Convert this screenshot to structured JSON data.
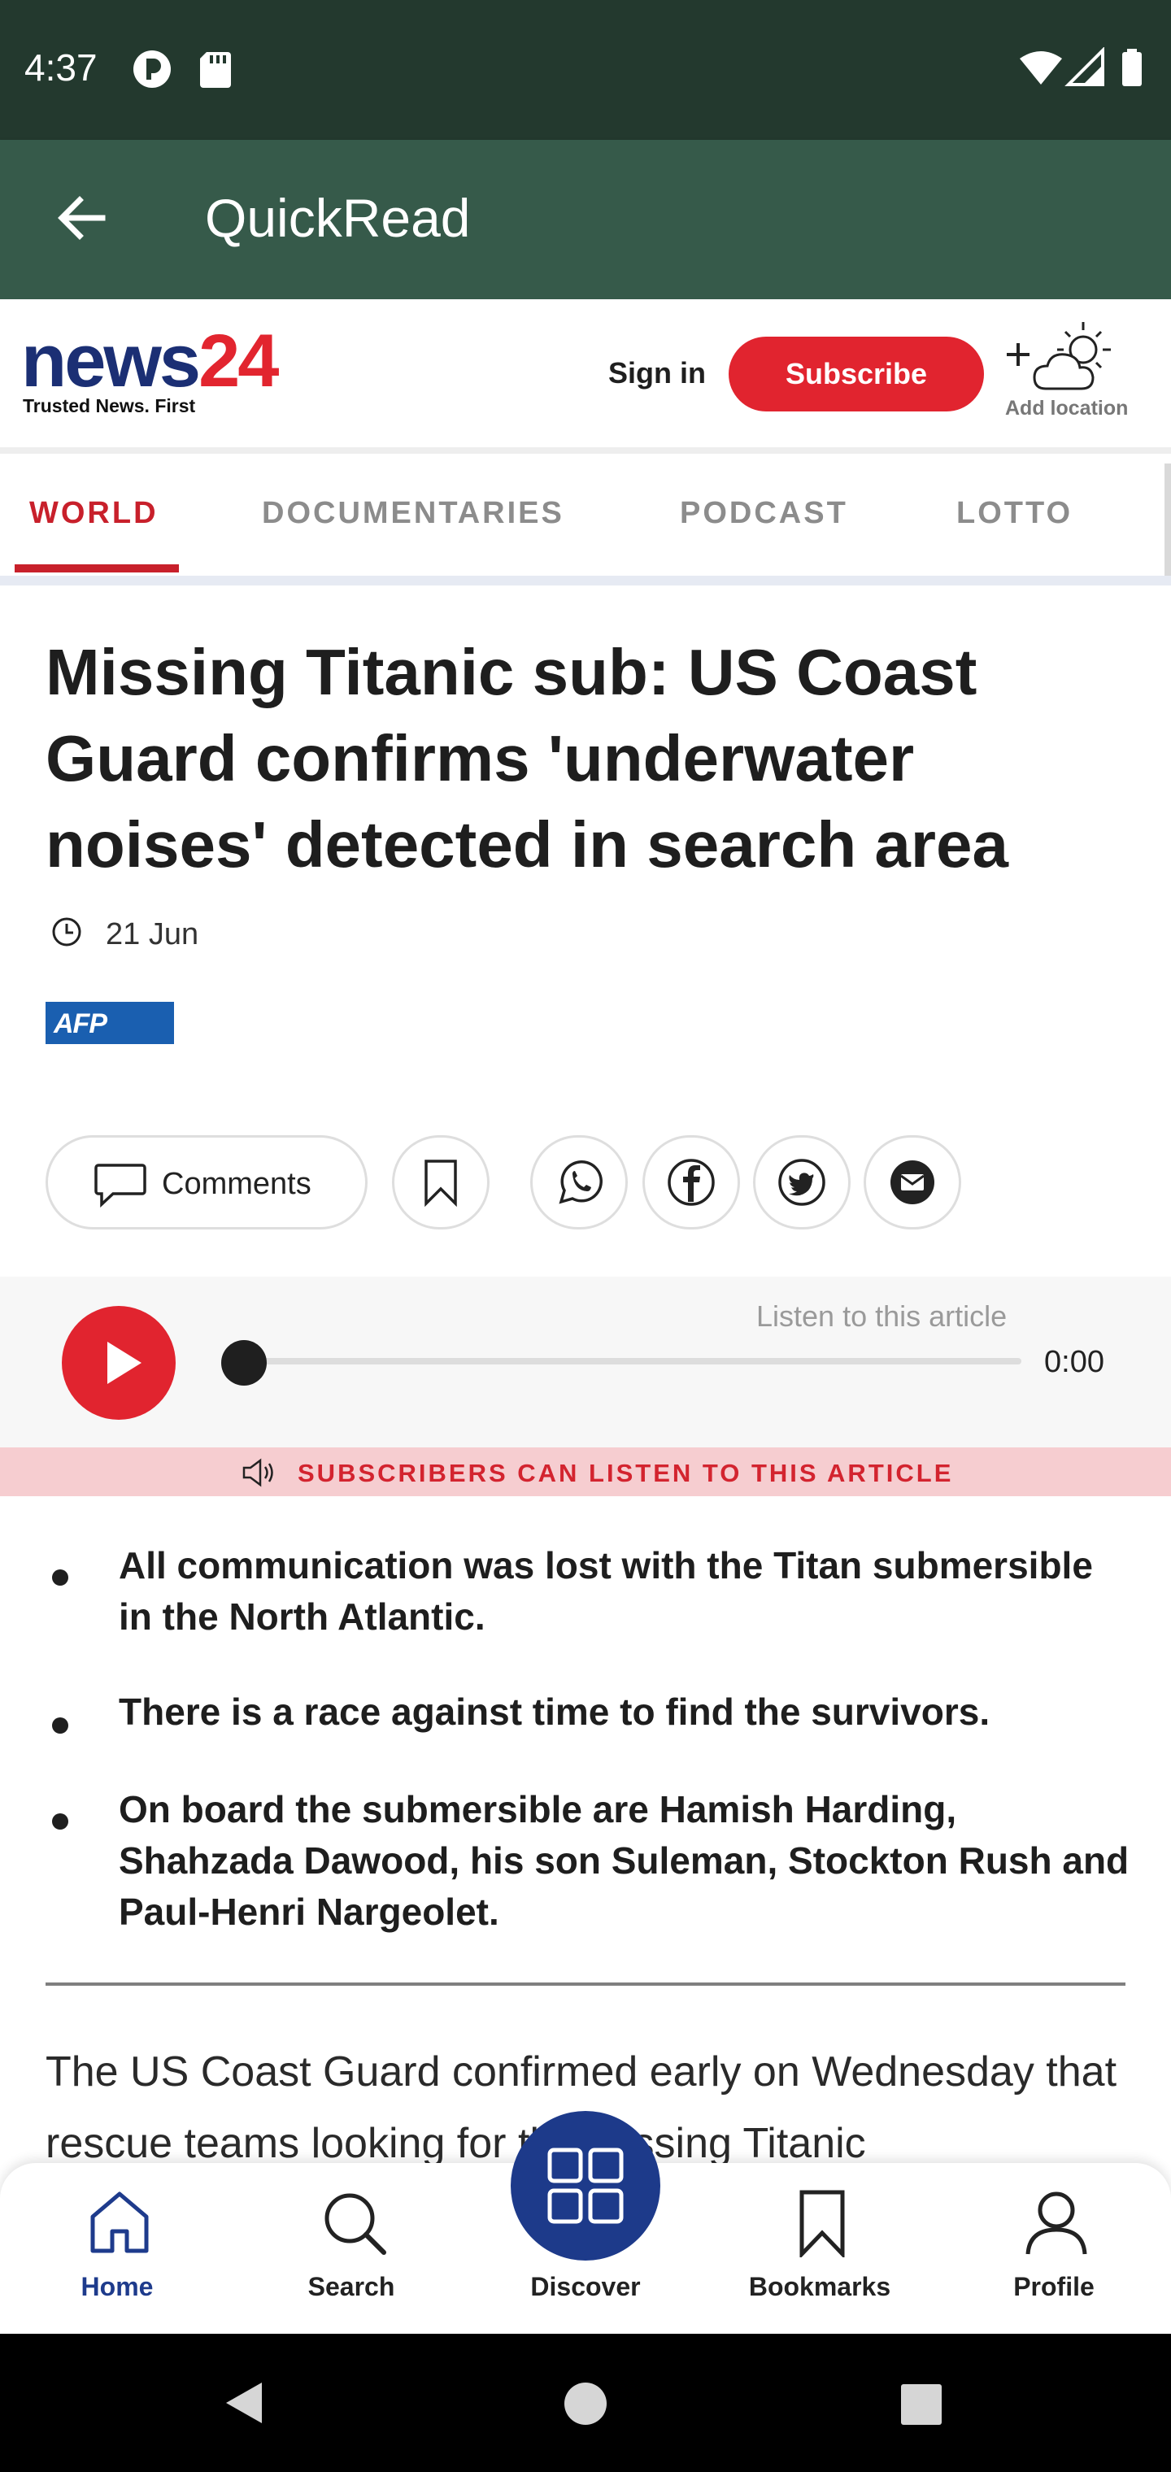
{
  "status_bar": {
    "time": "4:37"
  },
  "app_bar": {
    "title": "QuickRead"
  },
  "site_header": {
    "logo_main": "news",
    "logo_number": "24",
    "tagline": "Trusted News. First",
    "sign_in": "Sign in",
    "subscribe": "Subscribe",
    "add_location": "Add location"
  },
  "tabs": [
    {
      "label": "WORLD",
      "active": true
    },
    {
      "label": "DOCUMENTARIES",
      "active": false
    },
    {
      "label": "PODCAST",
      "active": false
    },
    {
      "label": "LOTTO",
      "active": false
    }
  ],
  "article": {
    "headline": "Missing Titanic sub: US Coast Guard confirms 'underwater noises' detected in search area",
    "date": "21 Jun",
    "source_logo": "AFP",
    "comments_label": "Comments",
    "bullets": [
      "All communication was lost with the Titan submersible in the North Atlantic.",
      "There is a race against time to find the survivors.",
      "On board the submersible are Hamish Harding, Shahzada Dawood, his son Suleman, Stockton Rush and Paul-Henri Nargeolet."
    ],
    "body_start": "The US Coast Guard confirmed early on Wednesday that rescue teams looking for the missing Titanic"
  },
  "player": {
    "listen_label": "Listen to this article",
    "time": "0:00",
    "progress": 0,
    "subscribers_notice": "SUBSCRIBERS CAN LISTEN TO THIS ARTICLE"
  },
  "bottom_nav": [
    {
      "label": "Home",
      "icon": "home-icon",
      "active": true
    },
    {
      "label": "Search",
      "icon": "search-icon",
      "active": false
    },
    {
      "label": "Discover",
      "icon": "grid-icon",
      "active": false
    },
    {
      "label": "Bookmarks",
      "icon": "bookmark-icon",
      "active": false
    },
    {
      "label": "Profile",
      "icon": "person-icon",
      "active": false
    }
  ],
  "colors": {
    "status_bar": "#23392e",
    "app_bar": "#365a4a",
    "brand_red": "#e1242f",
    "brand_navy": "#1b2f74",
    "discover": "#1d3a8a"
  }
}
